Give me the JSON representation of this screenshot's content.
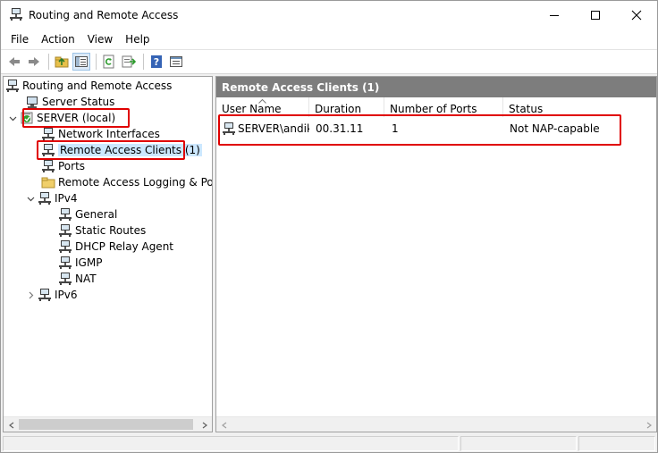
{
  "window": {
    "title": "Routing and Remote Access"
  },
  "menu": {
    "items": [
      "File",
      "Action",
      "View",
      "Help"
    ]
  },
  "toolbar": {
    "buttons": [
      "back-icon",
      "forward-icon",
      "up-folder-icon",
      "show-hide-tree-icon",
      "refresh-icon",
      "export-list-icon",
      "help-icon",
      "properties-icon"
    ]
  },
  "tree": {
    "root": "Routing and Remote Access",
    "server_status": "Server Status",
    "server": "SERVER (local)",
    "network_interfaces": "Network Interfaces",
    "remote_access_clients": "Remote Access Clients (1)",
    "ports": "Ports",
    "logging": "Remote Access Logging & Polic",
    "ipv4": "IPv4",
    "ipv4_children": [
      "General",
      "Static Routes",
      "DHCP Relay Agent",
      "IGMP",
      "NAT"
    ],
    "ipv6": "IPv6"
  },
  "details": {
    "header": "Remote Access Clients (1)",
    "columns": [
      "User Name",
      "Duration",
      "Number of Ports",
      "Status"
    ],
    "rows": [
      {
        "user": "SERVER\\andika",
        "duration": "00.31.11",
        "ports": "1",
        "status": "Not NAP-capable"
      }
    ]
  },
  "colors": {
    "highlight": "#e00000",
    "header_bg": "#7d7d7d"
  }
}
